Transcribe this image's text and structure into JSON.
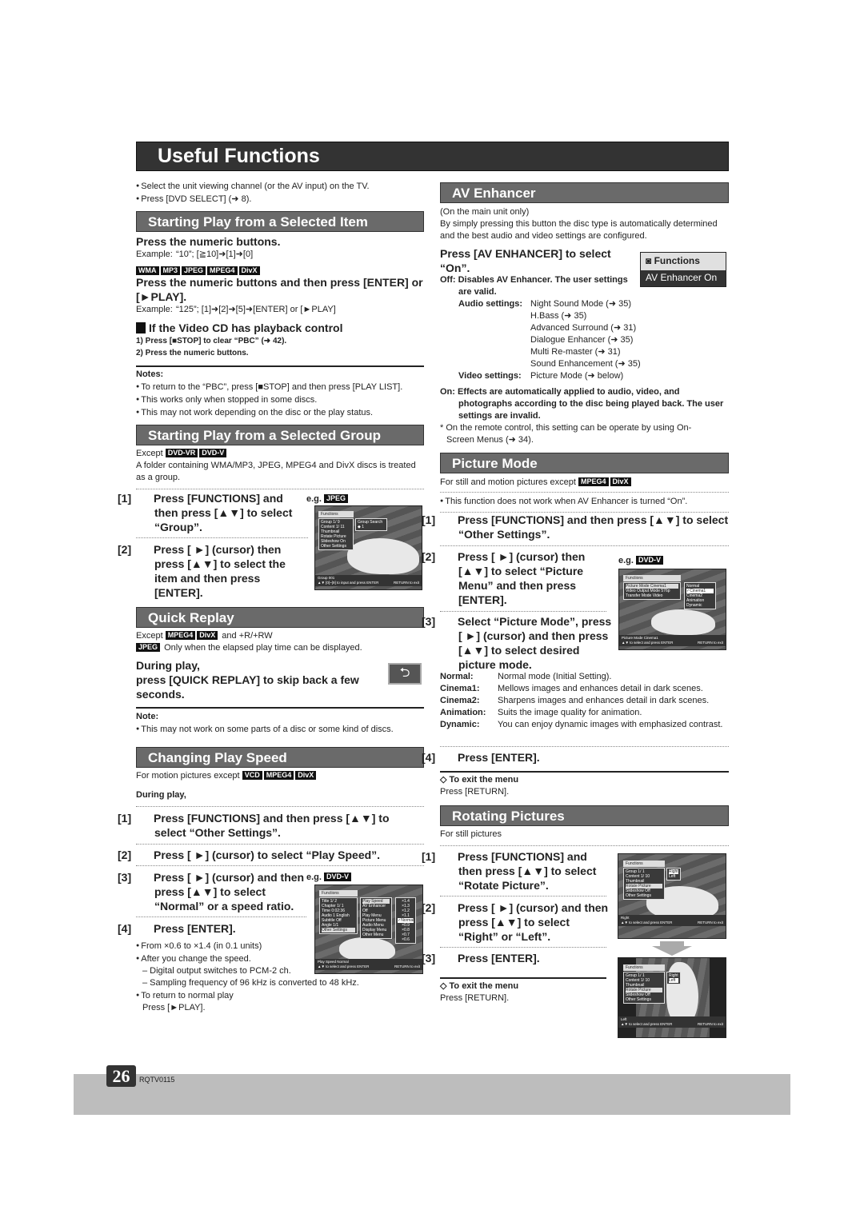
{
  "page_title": "Useful Functions",
  "intro": [
    "Select the unit viewing channel (or the AV input) on the TV.",
    "Press [DVD SELECT] (➜ 8)."
  ],
  "selected_item": {
    "heading": "Starting Play from a Selected Item",
    "sub1": "Press the numeric buttons.",
    "example1_label": "Example:",
    "example1": "“10”; [≧10]➜[1]➜[0]",
    "tags": [
      "WMA",
      "MP3",
      "JPEG",
      "MPEG4",
      "DivX"
    ],
    "sub2": "Press the numeric buttons and then press [ENTER] or [►PLAY].",
    "example2_label": "Example:",
    "example2": "“125”; [1]➜[2]➜[5]➜[ENTER] or [►PLAY]",
    "vcd_heading": "If the Video CD has playback control",
    "vcd_steps": [
      "1)  Press [■STOP] to clear “PBC” (➜ 42).",
      "2)  Press the numeric buttons."
    ],
    "notes_label": "Notes:",
    "notes": [
      "To return to the “PBC”, press [■STOP] and then press [PLAY LIST].",
      "This works only when stopped in some discs.",
      "This may not work depending on the disc or the play status."
    ]
  },
  "selected_group": {
    "heading": "Starting Play from a Selected Group",
    "except_label": "Except",
    "except_tags": [
      "DVD-VR",
      "DVD-V"
    ],
    "desc": "A folder containing WMA/MP3, JPEG, MPEG4 and DivX discs is treated as a group.",
    "step1_num": "[1]",
    "step1": "Press [FUNCTIONS] and then press [▲▼] to select “Group”.",
    "step2_num": "[2]",
    "step2": "Press [ ►] (cursor) then press [▲▼] to select the item and then press [ENTER].",
    "eg_label": "e.g.",
    "eg_tag": "JPEG",
    "screen": {
      "header": "Functions",
      "items": [
        "Group   1/ 9",
        "Content   1/ 11",
        "Thumbnail",
        "Rotate Picture",
        "Slideshow   On",
        "Other Settings"
      ],
      "popup": "Group Search ◆ 1",
      "status1": "Group 001",
      "status2": "▲▼ [0]~[9] to input and press ENTER",
      "status3": "RETURN to exit"
    }
  },
  "quick_replay": {
    "heading": "Quick Replay",
    "except_label": "Except",
    "except_tags": [
      "MPEG4",
      "DivX"
    ],
    "except_suffix": "and +R/+RW",
    "jpeg_tag": "JPEG",
    "jpeg_note": "Only when the elapsed play time can be displayed.",
    "instruction1": "During play,",
    "instruction2": "press [QUICK REPLAY] to skip back a few seconds.",
    "icon_glyph": "⮌",
    "note_label": "Note:",
    "note": "This may not work on some parts of a disc or some kind of discs."
  },
  "play_speed": {
    "heading": "Changing Play Speed",
    "for_text": "For motion pictures except",
    "tags": [
      "VCD",
      "MPEG4",
      "DivX"
    ],
    "during": "During play,",
    "step1_num": "[1]",
    "step1": "Press [FUNCTIONS] and then press [▲▼] to select “Other Settings”.",
    "step2_num": "[2]",
    "step2": "Press [ ►] (cursor) to select “Play Speed”.",
    "step3_num": "[3]",
    "step3": "Press [ ►] (cursor) and then press [▲▼] to select “Normal” or a speed ratio.",
    "step4_num": "[4]",
    "step4": "Press [ENTER].",
    "eg_label": "e.g.",
    "eg_tag": "DVD-V",
    "bullets": [
      "From ×0.6 to ×1.4 (in 0.1 units)",
      "After you change the speed."
    ],
    "dashes": [
      "– Digital output switches to PCM-2 ch.",
      "– Sampling frequency of 96 kHz is converted to 48 kHz."
    ],
    "bullet3": "To return to normal play",
    "bullet3b": "Press [►PLAY].",
    "screen": {
      "header": "Functions",
      "left": [
        "Title   1/ 2",
        "Chapter   1/ 1",
        "Time   0:02:36",
        "Audio   1 English",
        "Subtitle   Off",
        "Angle   1/1",
        "Other Settings"
      ],
      "mid": [
        "Play Speed",
        "AV Enhancer  Off",
        "Play Menu",
        "Picture Menu",
        "Audio Menu",
        "Display Menu",
        "Other Menu"
      ],
      "right": [
        "×1.4",
        "×1.3",
        "×1.2",
        "×1.1",
        "✓Normal",
        "×0.9",
        "×0.8",
        "×0.7",
        "×0.6"
      ],
      "status1": "Play Speed Normal",
      "status2": "▲▼ to select and press ENTER",
      "status3": "RETURN to exit"
    }
  },
  "av_enhancer": {
    "heading": "AV Enhancer",
    "line1": "(On the main unit only)",
    "line2": "By simply pressing this button the disc type is automatically determined and the best audio and video settings are configured.",
    "instruction": "Press [AV ENHANCER] to select “On”.",
    "box_title": "Functions",
    "box_value": "AV Enhancer   On",
    "off_label": "Off:",
    "off_text": "Disables AV Enhancer. The user settings are valid.",
    "audio_label": "Audio settings:",
    "audio_items": [
      "Night Sound Mode (➜ 35)",
      "H.Bass (➜ 35)",
      "Advanced Surround (➜ 31)",
      "Dialogue Enhancer (➜ 35)",
      "Multi Re-master (➜ 31)",
      "Sound Enhancement (➜ 35)"
    ],
    "video_label": "Video settings:",
    "video_item": "Picture Mode (➜ below)",
    "on_label": "On:",
    "on_text": "Effects are automatically applied to audio, video, and photographs according to the disc being played back. The user settings are invalid.",
    "footnote": "* On the remote control, this setting can be operate by using On-Screen Menus (➜ 34)."
  },
  "picture_mode": {
    "heading": "Picture Mode",
    "for_text": "For still and motion pictures except",
    "tags": [
      "MPEG4",
      "DivX"
    ],
    "bullet": "This function does not work when AV Enhancer is turned “On”.",
    "step1_num": "[1]",
    "step1": "Press [FUNCTIONS] and then press [▲▼] to select “Other Settings”.",
    "step2_num": "[2]",
    "step2": "Press [ ►] (cursor) then [▲▼] to select “Picture Menu” and then press [ENTER].",
    "step3_num": "[3]",
    "step3": "Select “Picture Mode”, press [ ►] (cursor) and then press [▲▼] to select desired picture mode.",
    "eg_label": "e.g.",
    "eg_tag": "DVD-V",
    "modes": [
      {
        "k": "Normal:",
        "v": "Normal mode (Initial Setting)."
      },
      {
        "k": "Cinema1:",
        "v": "Mellows images and enhances detail in dark scenes."
      },
      {
        "k": "Cinema2:",
        "v": "Sharpens images and enhances detail in dark scenes."
      },
      {
        "k": "Animation:",
        "v": "Suits the image quality for animation."
      },
      {
        "k": "Dynamic:",
        "v": "You can enjoy dynamic images with emphasized contrast."
      }
    ],
    "step4_num": "[4]",
    "step4": "Press [ENTER].",
    "exit_label": "◇ To exit the menu",
    "exit_text": "Press [RETURN].",
    "screen": {
      "header": "Functions",
      "left": [
        "Picture Mode   Cinema1",
        "Video Output Mode   576p",
        "Transfer Mode   Video"
      ],
      "right": [
        "Normal",
        "✓Cinema1",
        "Cinema2",
        "Animation",
        "Dynamic"
      ],
      "status1": "Picture Mode Cinema1",
      "status2": "▲▼ to select and press ENTER",
      "status3": "RETURN to exit"
    }
  },
  "rotating": {
    "heading": "Rotating Pictures",
    "for_text": "For still pictures",
    "step1_num": "[1]",
    "step1": "Press [FUNCTIONS] and then press [▲▼] to select “Rotate Picture”.",
    "step2_num": "[2]",
    "step2": "Press [ ►] (cursor) and then press [▲▼] to select “Right” or “Left”.",
    "step3_num": "[3]",
    "step3": "Press [ENTER].",
    "exit_label": "◇ To exit the menu",
    "exit_text": "Press [RETURN].",
    "screen1": {
      "header": "Functions",
      "items": [
        "Group   1/ 1",
        "Content   1/ 10",
        "Thumbnail",
        "Rotate Picture",
        "Slideshow   Off",
        "Other Settings"
      ],
      "popup": [
        "Right",
        "Left"
      ],
      "status1": "Right",
      "status2": "▲▼ to select and press ENTER",
      "status3": "RETURN to exit"
    },
    "screen2": {
      "header": "Functions",
      "items": [
        "Group   1/ 1",
        "Content   1/ 10",
        "Thumbnail",
        "Rotate Picture",
        "Slideshow   Off",
        "Other Settings"
      ],
      "popup": [
        "Right",
        "Left"
      ],
      "status1": "Left",
      "status2": "▲▼ to select and press ENTER",
      "status3": "RETURN to exit"
    }
  },
  "footer": {
    "page_number": "26",
    "code": "RQTV0115"
  }
}
